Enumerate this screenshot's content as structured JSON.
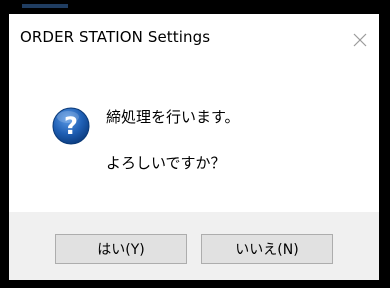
{
  "dialog": {
    "title": "ORDER STATION Settings",
    "message_line1": "締処理を行います。",
    "message_line2": "よろしいですか？",
    "buttons": {
      "yes_label": "はい(Y)",
      "no_label": "いいえ(N)"
    }
  },
  "icons": {
    "message_icon": "question-icon",
    "close_icon": "close-icon"
  },
  "colors": {
    "dialog_background": "#ffffff",
    "footer_background": "#f0f0f0",
    "button_face": "#e1e1e1",
    "button_border": "#adadad",
    "question_icon_blue": "#1f5fb4"
  }
}
